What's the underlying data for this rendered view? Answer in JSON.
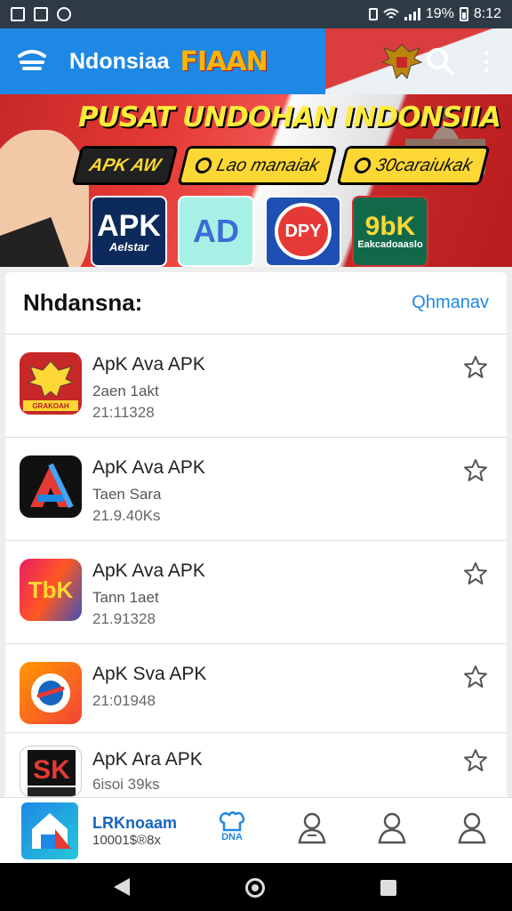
{
  "status_bar": {
    "battery_text": "19%",
    "time": "8:12"
  },
  "app_bar": {
    "title": "Ndonsiaa",
    "brand": "FIAAN"
  },
  "banner": {
    "title": "PUSAT UNDOHAN INDONSIIA",
    "chips": [
      "APK AW",
      "Lao manaiak",
      "30caraiukak"
    ],
    "tiles": [
      {
        "label": "APK",
        "caption": "Aelstar"
      },
      {
        "label": "AD"
      },
      {
        "label": "DPY"
      },
      {
        "label": "9bK",
        "caption": "Eakcadoaaslo"
      }
    ]
  },
  "section": {
    "title": "Nhdansna:",
    "action": "Qhmanav"
  },
  "apps": [
    {
      "name": "ApK Ava APK",
      "subtitle": "2aen 1akt",
      "meta": "21:11328",
      "icon": "garuda-app-icon",
      "icon_caption": "GRAKOAH"
    },
    {
      "name": "ApK Ava APK",
      "subtitle": "Taen Sara",
      "meta": "21.9.40Ks",
      "icon": "delta-app-icon"
    },
    {
      "name": "ApK Ava APK",
      "subtitle": "Tann 1aet",
      "meta": "21.91328",
      "icon": "tbk-app-icon",
      "icon_text": "TbK"
    },
    {
      "name": "ApK Sva APK",
      "meta": "21:01948",
      "icon": "radar-app-icon"
    },
    {
      "name": "ApK Ara APK",
      "meta": "6isoi 39ks",
      "icon": "sk-app-icon",
      "icon_text": "SK"
    }
  ],
  "bottom_bar": {
    "app_name": "LRKnoaam",
    "app_meta": "10001$®8x",
    "home_tab_label": "DNA"
  },
  "colors": {
    "primary": "#1e88e5",
    "accent": "#fdd835",
    "red": "#e53935"
  }
}
